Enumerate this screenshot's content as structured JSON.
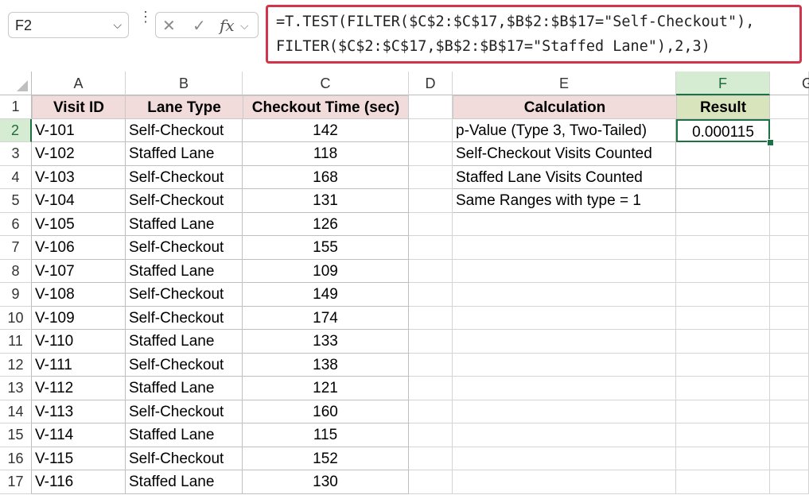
{
  "namebox": {
    "value": "F2",
    "arrow": "⌵"
  },
  "toolbar": {
    "dots": "⋮",
    "cancel": "✕",
    "enter": "✓",
    "fx": "fx",
    "fx_arrow": "⌵"
  },
  "formula": {
    "line1": "=T.TEST(FILTER($C$2:$C$17,$B$2:$B$17=\"Self-Checkout\"),",
    "line2": "FILTER($C$2:$C$17,$B$2:$B$17=\"Staffed Lane\"),2,3)"
  },
  "columns": [
    "A",
    "B",
    "C",
    "D",
    "E",
    "F",
    "G"
  ],
  "rows": [
    "1",
    "2",
    "3",
    "4",
    "5",
    "6",
    "7",
    "8",
    "9",
    "10",
    "11",
    "12",
    "13",
    "14",
    "15",
    "16",
    "17"
  ],
  "table": {
    "headers": [
      "Visit ID",
      "Lane Type",
      "Checkout Time (sec)"
    ],
    "rows": [
      [
        "V-101",
        "Self-Checkout",
        "142"
      ],
      [
        "V-102",
        "Staffed Lane",
        "118"
      ],
      [
        "V-103",
        "Self-Checkout",
        "168"
      ],
      [
        "V-104",
        "Self-Checkout",
        "131"
      ],
      [
        "V-105",
        "Staffed Lane",
        "126"
      ],
      [
        "V-106",
        "Self-Checkout",
        "155"
      ],
      [
        "V-107",
        "Staffed Lane",
        "109"
      ],
      [
        "V-108",
        "Self-Checkout",
        "149"
      ],
      [
        "V-109",
        "Self-Checkout",
        "174"
      ],
      [
        "V-110",
        "Staffed Lane",
        "133"
      ],
      [
        "V-111",
        "Self-Checkout",
        "138"
      ],
      [
        "V-112",
        "Staffed Lane",
        "121"
      ],
      [
        "V-113",
        "Self-Checkout",
        "160"
      ],
      [
        "V-114",
        "Staffed Lane",
        "115"
      ],
      [
        "V-115",
        "Self-Checkout",
        "152"
      ],
      [
        "V-116",
        "Staffed Lane",
        "130"
      ]
    ]
  },
  "calc": {
    "headers": [
      "Calculation",
      "Result"
    ],
    "rows": [
      [
        "p-Value (Type 3, Two-Tailed)",
        "0.000115"
      ],
      [
        "Self-Checkout Visits Counted",
        ""
      ],
      [
        "Staffed Lane Visits Counted",
        ""
      ],
      [
        "Same Ranges with type = 1",
        ""
      ]
    ]
  },
  "colors": {
    "accent": "#1e7145",
    "formula_border": "#d2344c",
    "header_pink": "#f2dcdb",
    "header_green": "#d8e4bc"
  }
}
